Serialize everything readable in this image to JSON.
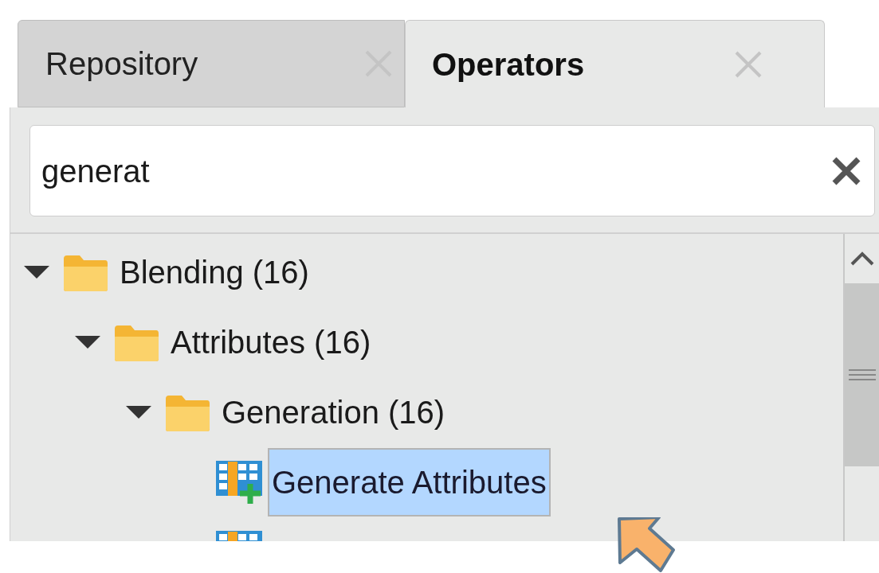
{
  "tabs": [
    {
      "label": "Repository",
      "selected": false
    },
    {
      "label": "Operators",
      "selected": true
    }
  ],
  "search": {
    "value": "generat"
  },
  "tree": [
    {
      "kind": "folder",
      "label": "Blending (16)",
      "expanded": true,
      "children": [
        {
          "kind": "folder",
          "label": "Attributes (16)",
          "expanded": true,
          "children": [
            {
              "kind": "folder",
              "label": "Generation (16)",
              "expanded": true,
              "children": [
                {
                  "kind": "operator",
                  "label": "Generate Attributes",
                  "selected": true
                },
                {
                  "kind": "operator",
                  "selected": false
                }
              ]
            }
          ]
        }
      ]
    }
  ]
}
